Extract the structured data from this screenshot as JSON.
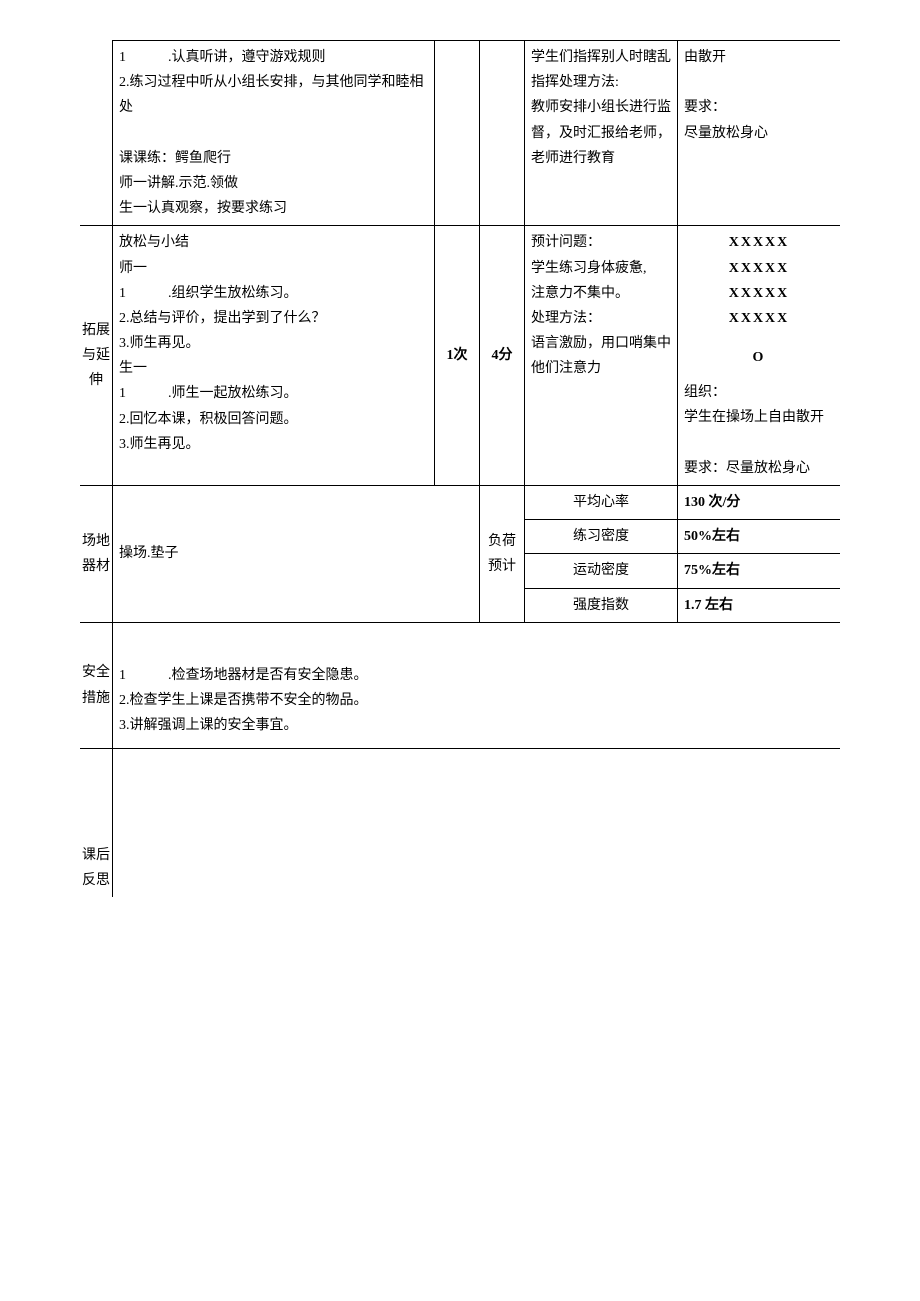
{
  "row1": {
    "content": "1　　　.认真听讲，遵守游戏规则\n2.练习过程中听从小组长安排，与其他同学和睦相处\n\n课课练：鳄鱼爬行\n师一讲解.示范.领做\n生一认真观察，按要求练习",
    "problem": "学生们指挥别人时瞎乱指挥处理方法:\n教师安排小组长进行监督，及时汇报给老师，老师进行教育",
    "org": "由散开\n\n要求：\n尽量放松身心"
  },
  "row2": {
    "label": "拓展与延伸",
    "content": "放松与小结\n师一\n1　　　.组织学生放松练习。\n2.总结与评价，提出学到了什么？\n3.师生再见。\n生一\n1　　　.师生一起放松练习。\n2.回忆本课，积极回答问题。\n3.师生再见。",
    "count": "1次",
    "min": "4分",
    "problem": "预计问题：\n学生练习身体疲惫,\n注意力不集中。\n处理方法：\n语言激励，用口哨集中他们注意力",
    "diagram_lines": [
      "XXXXX",
      "XXXXX",
      "XXXXX",
      "XXXXX",
      "",
      "O"
    ],
    "org_text": "组织：\n学生在操场上自由散开\n\n要求：尽量放松身心"
  },
  "row3": {
    "label": "场地器材",
    "content": "操场.垫子",
    "load_label": "负荷预计",
    "metrics": [
      {
        "label": "平均心率",
        "value": "130 次/分"
      },
      {
        "label": "练习密度",
        "value": "50%左右"
      },
      {
        "label": "运动密度",
        "value": "75%左右"
      },
      {
        "label": "强度指数",
        "value": "1.7 左右"
      }
    ]
  },
  "row4": {
    "label": "安全措施",
    "content": "1　　　.检查场地器材是否有安全隐患。\n2.检查学生上课是否携带不安全的物品。\n3.讲解强调上课的安全事宜。"
  },
  "row5": {
    "label": "课后反思",
    "content": ""
  }
}
